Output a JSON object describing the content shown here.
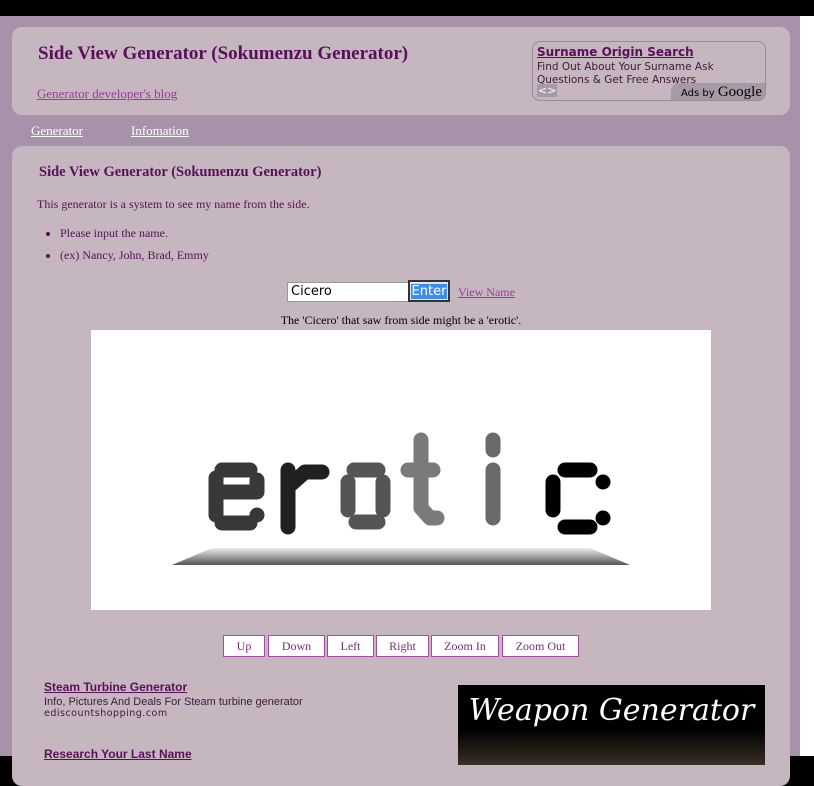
{
  "header": {
    "title": "Side View Generator (Sokumenzu Generator)",
    "blog_link": "Generator developer's blog"
  },
  "ad": {
    "title": "Surname Origin Search",
    "text": "Find Out About Your Surname Ask Questions & Get Free Answers",
    "nav": "<>",
    "ads_by": "Ads by",
    "google": "Google"
  },
  "menu": [
    {
      "label": "Generator"
    },
    {
      "label": "Infomation"
    }
  ],
  "main": {
    "heading": "Side View Generator (Sokumenzu Generator)",
    "intro": "This generator is a system to see my name from the side.",
    "bullets": [
      "Please input the name.",
      "(ex) Nancy, John, Brad, Emmy"
    ],
    "name_value": "Cicero",
    "enter_label": "Enter",
    "view_name": "View Name",
    "result": "The 'Cicero' that saw from side might be a 'erotic'.",
    "side_word": "erotic"
  },
  "controls": [
    "Up",
    "Down",
    "Left",
    "Right",
    "Zoom In",
    "Zoom Out"
  ],
  "text_ads": [
    {
      "title": "Steam Turbine Generator",
      "desc": "Info, Pictures And Deals For Steam turbine generator",
      "url": "ediscountshopping.com"
    },
    {
      "title": "Research Your Last Name"
    }
  ],
  "banner": {
    "title": "Weapon Generator"
  }
}
